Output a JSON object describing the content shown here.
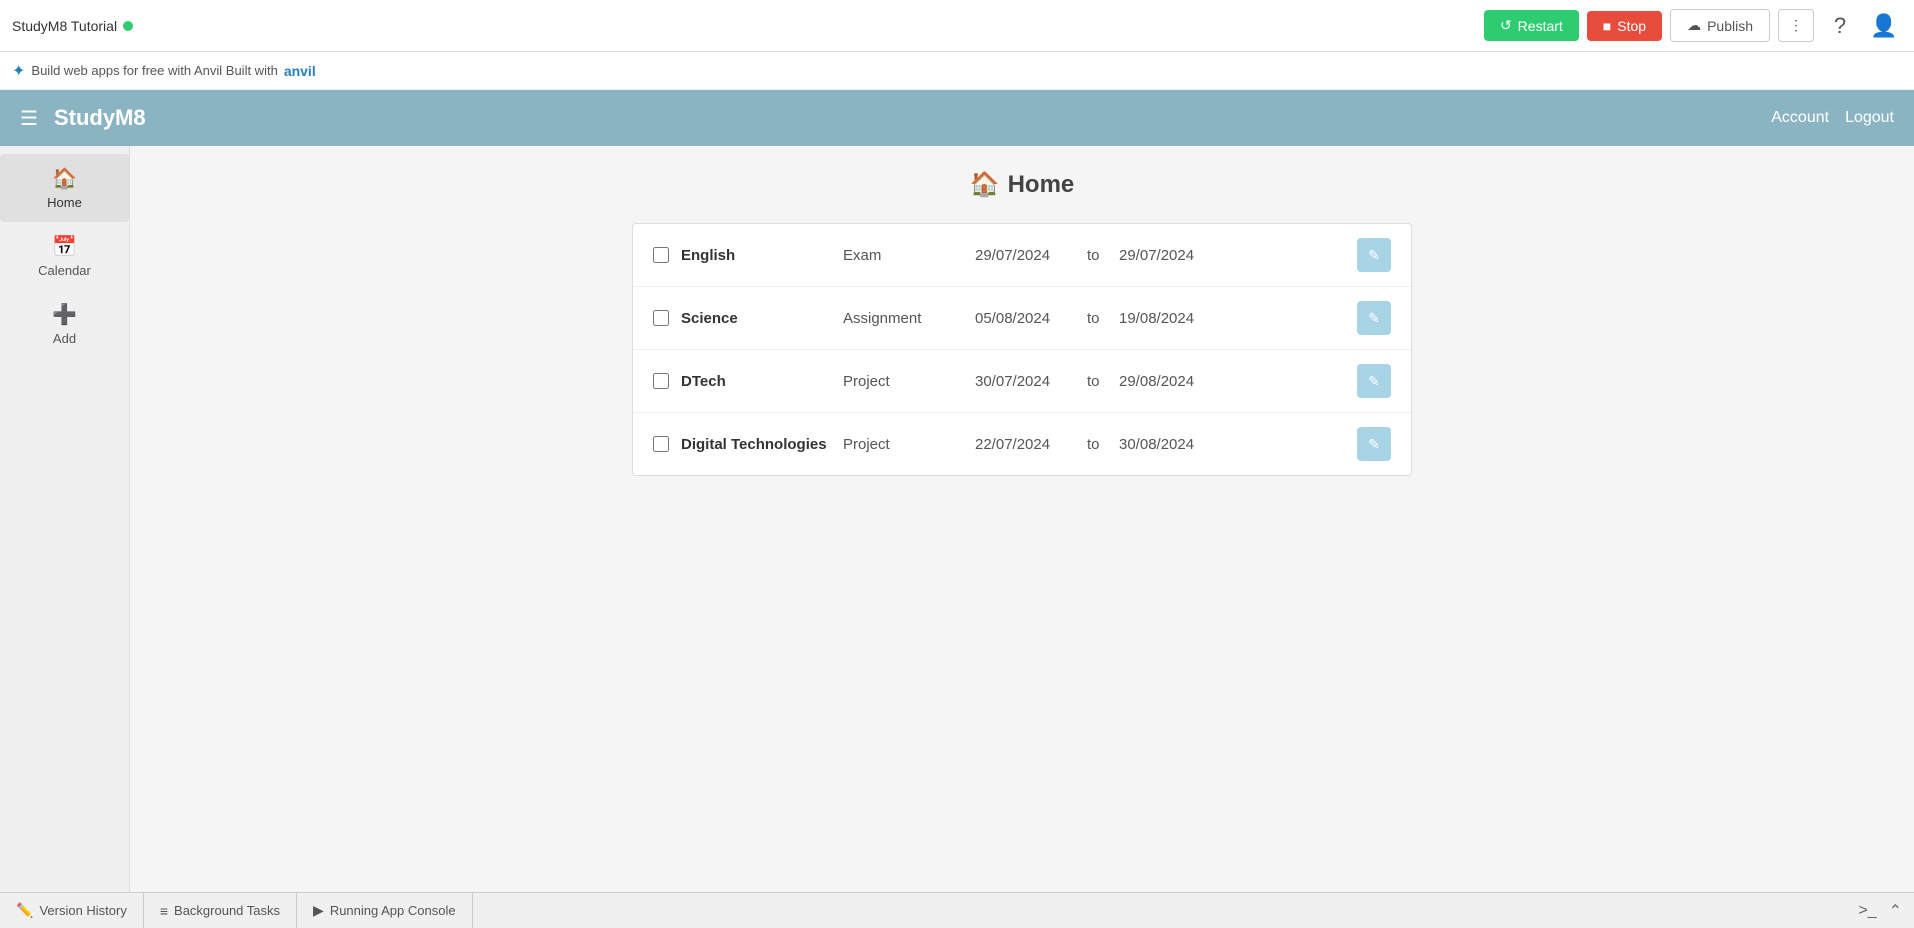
{
  "toolbar": {
    "app_title": "StudyM8 Tutorial",
    "restart_label": "Restart",
    "stop_label": "Stop",
    "publish_label": "Publish",
    "more_label": "⋮"
  },
  "anvil_banner": {
    "text": "Build web apps for free with Anvil Built with"
  },
  "app_navbar": {
    "app_name": "StudyM8",
    "account_label": "Account",
    "logout_label": "Logout"
  },
  "sidebar": {
    "items": [
      {
        "label": "Home",
        "icon": "🏠",
        "active": true
      },
      {
        "label": "Calendar",
        "icon": "📅",
        "active": false
      },
      {
        "label": "Add",
        "icon": "➕",
        "active": false
      }
    ]
  },
  "main": {
    "page_title": "Home",
    "tasks": [
      {
        "subject": "English",
        "type": "Exam",
        "date_start": "29/07/2024",
        "date_end": "29/07/2024"
      },
      {
        "subject": "Science",
        "type": "Assignment",
        "date_start": "05/08/2024",
        "date_end": "19/08/2024"
      },
      {
        "subject": "DTech",
        "type": "Project",
        "date_start": "30/07/2024",
        "date_end": "29/08/2024"
      },
      {
        "subject": "Digital Technologies",
        "type": "Project",
        "date_start": "22/07/2024",
        "date_end": "30/08/2024"
      }
    ]
  },
  "bottom": {
    "version_history_label": "Version History",
    "background_tasks_label": "Background Tasks",
    "running_console_label": "Running App Console"
  },
  "colors": {
    "navbar_bg": "#8ab4c2",
    "restart_btn": "#2ecc71",
    "stop_btn": "#e74c3c",
    "edit_btn": "#a8d4e6"
  }
}
